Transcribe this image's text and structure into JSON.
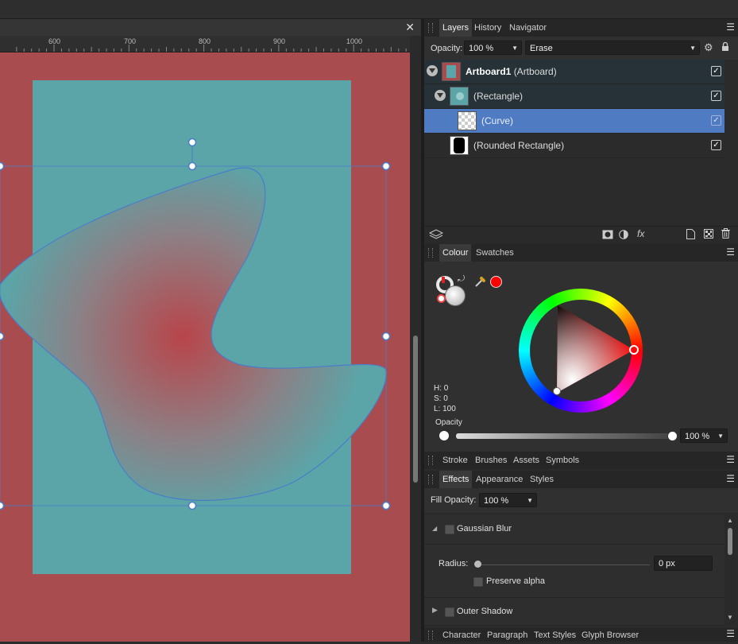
{
  "document": {
    "close_label": "✕",
    "ruler_ticks": [
      "600",
      "700",
      "800",
      "900",
      "1000"
    ]
  },
  "layers_panel": {
    "tabs": [
      "Layers",
      "History",
      "Navigator"
    ],
    "active_tab": "Layers",
    "opacity_label": "Opacity:",
    "opacity_value": "100 %",
    "blend_mode": "Erase",
    "rows": [
      {
        "name": "Artboard1",
        "suffix": "(Artboard)",
        "checked": true
      },
      {
        "name": "(Rectangle)",
        "checked": true
      },
      {
        "name": "(Curve)",
        "checked": true,
        "selected": true
      },
      {
        "name": "(Rounded Rectangle)",
        "checked": true
      }
    ]
  },
  "colour_panel": {
    "tabs": [
      "Colour",
      "Swatches"
    ],
    "active_tab": "Colour",
    "h_label": "H: 0",
    "s_label": "S: 0",
    "l_label": "L: 100",
    "opacity_label": "Opacity",
    "opacity_value": "100 %",
    "accent": "#ff0000"
  },
  "stroke_tabs": [
    "Stroke",
    "Brushes",
    "Assets",
    "Symbols"
  ],
  "effects_panel": {
    "tabs": [
      "Effects",
      "Appearance",
      "Styles"
    ],
    "active_tab": "Effects",
    "fill_opacity_label": "Fill Opacity:",
    "fill_opacity_value": "100 %",
    "gaussian_blur": "Gaussian Blur",
    "radius_label": "Radius:",
    "radius_value": "0 px",
    "preserve_alpha": "Preserve alpha",
    "outer_shadow": "Outer Shadow"
  },
  "bottom_tabs": [
    "Character",
    "Paragraph",
    "Text Styles",
    "Glyph Browser"
  ],
  "colors": {
    "canvas_bg": "#a84c50",
    "artboard": "#5ba5a8",
    "selection": "#4a7dc9",
    "selected_row": "#4f7bc2"
  }
}
